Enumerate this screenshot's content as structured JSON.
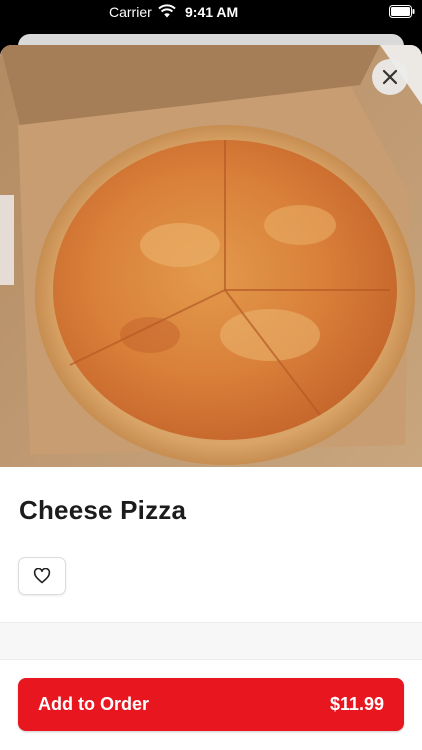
{
  "status_bar": {
    "carrier": "Carrier",
    "time": "9:41 AM",
    "wifi_icon": "wifi-icon",
    "battery_icon": "battery-icon"
  },
  "item": {
    "image_icon": "pizza-photo",
    "close_icon": "close-icon",
    "title": "Cheese Pizza",
    "favorite_icon": "heart-outline-icon"
  },
  "footer": {
    "add_label": "Add to Order",
    "price": "$11.99"
  },
  "colors": {
    "accent": "#e8161f",
    "text": "#1c1c1c"
  }
}
